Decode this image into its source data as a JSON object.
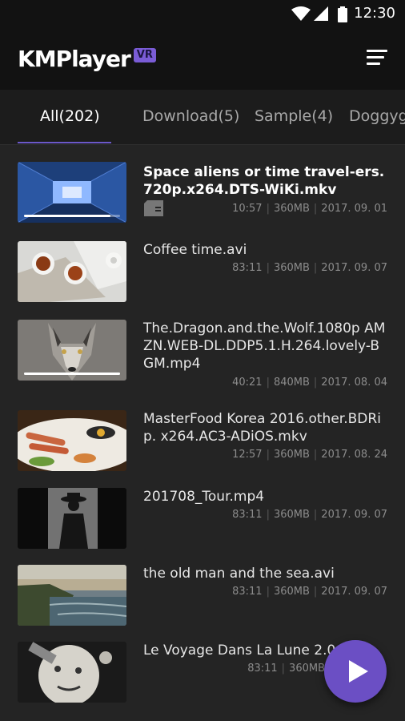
{
  "status_bar": {
    "time": "12:30"
  },
  "app": {
    "logo": "KMPlayer",
    "badge": "VR"
  },
  "tabs": [
    {
      "label": "All(202)"
    },
    {
      "label": "Download(5)"
    },
    {
      "label": "Sample(4)"
    },
    {
      "label": "Doggygr"
    }
  ],
  "videos": [
    {
      "title": "Space aliens or time travel-ers.720p.x264.DTS-WiKi.mkv",
      "duration": "10:57",
      "size": "360MB",
      "date": "2017. 09. 01",
      "thumb_icon": "tunnel-thumbnail",
      "progress": 0.9,
      "on_sd_card": true
    },
    {
      "title": "Coffee time.avi",
      "duration": "83:11",
      "size": "360MB",
      "date": "2017. 09. 07",
      "thumb_icon": "coffee-thumbnail"
    },
    {
      "title": "The.Dragon.and.the.Wolf.1080p AMZN.WEB-DL.DDP5.1.H.264.lovely-BGM.mp4",
      "duration": "40:21",
      "size": "840MB",
      "date": "2017. 08. 04",
      "thumb_icon": "wolf-thumbnail",
      "progress": 1.0
    },
    {
      "title": "MasterFood Korea 2016.other.BDRip. x264.AC3-ADiOS.mkv",
      "duration": "12:57",
      "size": "360MB",
      "date": "2017. 08. 24",
      "thumb_icon": "food-thumbnail"
    },
    {
      "title": "201708_Tour.mp4",
      "duration": "83:11",
      "size": "360MB",
      "date": "2017. 09. 07",
      "thumb_icon": "silhouette-thumbnail"
    },
    {
      "title": "the old man and the sea.avi",
      "duration": "83:11",
      "size": "360MB",
      "date": "2017. 09. 07",
      "thumb_icon": "seascape-thumbnail"
    },
    {
      "title": "Le Voyage Dans La Lune 2.0.m",
      "duration": "83:11",
      "size": "360MB",
      "date": "",
      "thumb_icon": "moon-thumbnail"
    }
  ],
  "colors": {
    "accent": "#6b4fc4",
    "background": "#242424",
    "topbar": "#121212"
  },
  "fab": {
    "icon": "play-icon"
  }
}
